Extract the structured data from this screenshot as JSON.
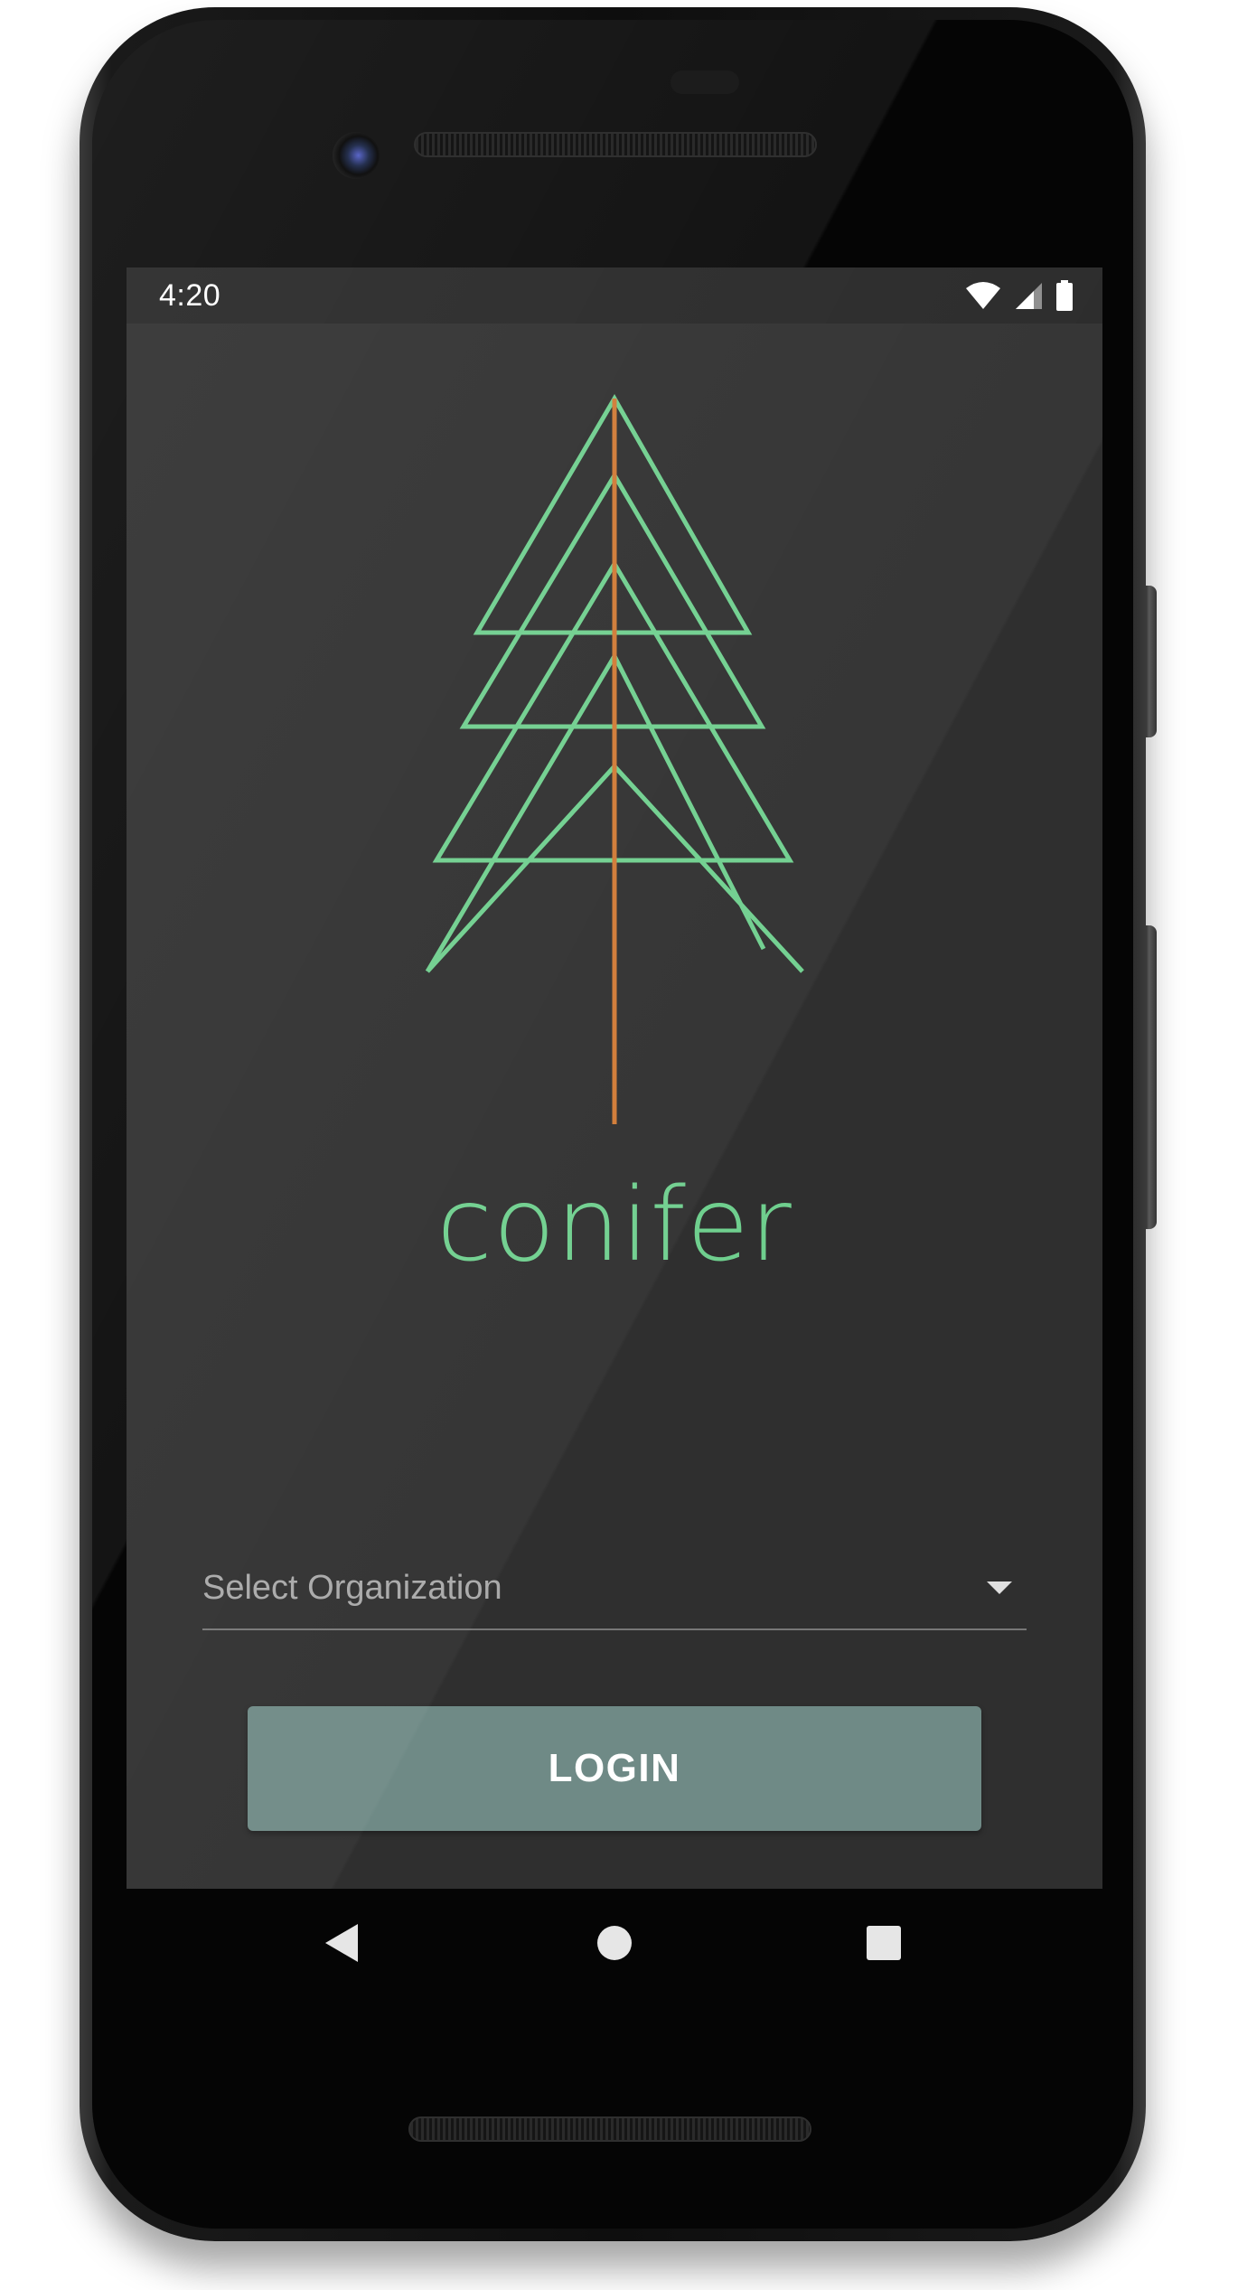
{
  "status_bar": {
    "time": "4:20",
    "icons": [
      "wifi-icon",
      "cell-signal-icon",
      "battery-icon"
    ]
  },
  "app": {
    "name": "conifer",
    "logo": "conifer-tree-logo",
    "colors": {
      "brand_green": "#6fcf8e",
      "trunk_orange": "#d07a35",
      "button": "#6f8a86",
      "background": "#2f2f2f"
    }
  },
  "form": {
    "organization_placeholder": "Select Organization",
    "login_label": "LOGIN"
  },
  "navigation": {
    "buttons": [
      "back-icon",
      "home-icon",
      "overview-icon"
    ]
  }
}
